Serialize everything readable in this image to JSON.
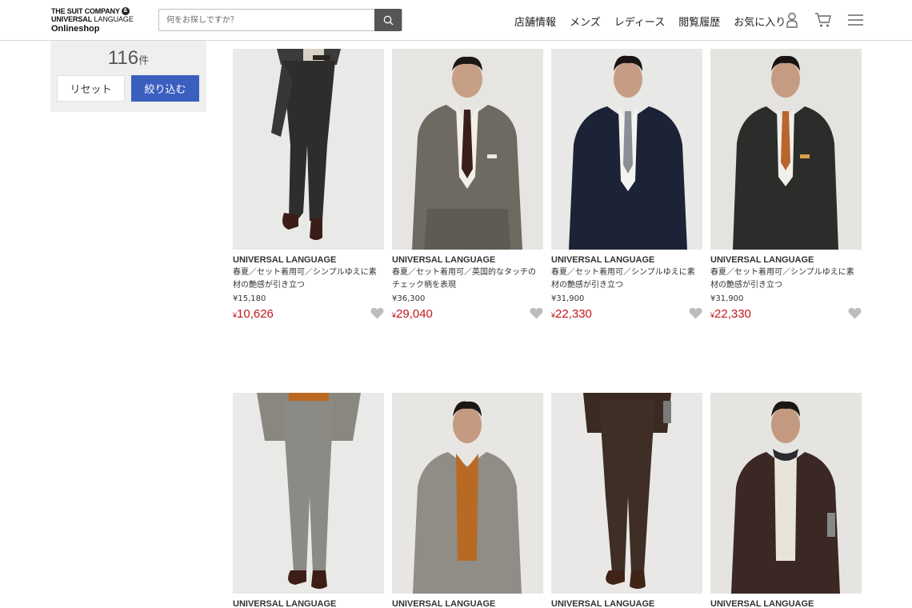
{
  "header": {
    "logo": {
      "line1": "THE SUIT COMPANY",
      "amp": "&",
      "line2a": "UNIVERSAL",
      "line2b": "LANGUAGE",
      "line3": "Onlineshop"
    },
    "search": {
      "placeholder": "何をお探しですか？"
    },
    "nav": [
      "店舗情報",
      "メンズ",
      "レディース",
      "閲覧履歴",
      "お気に入り"
    ],
    "icons": [
      "user-icon",
      "cart-icon",
      "menu-icon"
    ]
  },
  "filter": {
    "count": "116",
    "count_unit": "件",
    "reset_label": "リセット",
    "apply_label": "絞り込む"
  },
  "colors": {
    "accent": "#3a5fbf",
    "price": "#c4161c"
  },
  "products": [
    {
      "brand": "UNIVERSAL LANGUAGE",
      "desc": "春夏／セット着用可／シンプルゆえに素材の艶感が引き立つ",
      "orig": "¥15,180",
      "yen": "¥",
      "price": "10,626"
    },
    {
      "brand": "UNIVERSAL LANGUAGE",
      "desc": "春夏／セット着用可／英国的なタッチのチェック柄を表現",
      "orig": "¥36,300",
      "yen": "¥",
      "price": "29,040"
    },
    {
      "brand": "UNIVERSAL LANGUAGE",
      "desc": "春夏／セット着用可／シンプルゆえに素材の艶感が引き立つ",
      "orig": "¥31,900",
      "yen": "¥",
      "price": "22,330"
    },
    {
      "brand": "UNIVERSAL LANGUAGE",
      "desc": "春夏／セット着用可／シンプルゆえに素材の艶感が引き立つ",
      "orig": "¥31,900",
      "yen": "¥",
      "price": "22,330"
    },
    {
      "brand": "UNIVERSAL LANGUAGE"
    },
    {
      "brand": "UNIVERSAL LANGUAGE"
    },
    {
      "brand": "UNIVERSAL LANGUAGE"
    },
    {
      "brand": "UNIVERSAL LANGUAGE"
    }
  ]
}
